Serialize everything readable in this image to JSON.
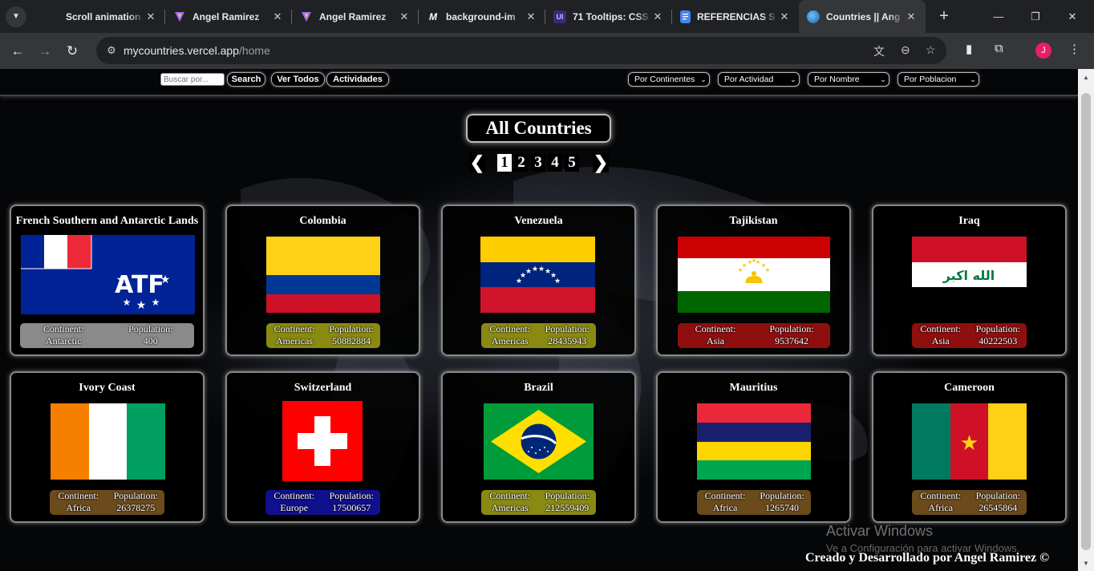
{
  "browser": {
    "tabs": [
      {
        "title": "Scroll animation",
        "icon": "blank-icon"
      },
      {
        "title": "Angel Ramirez",
        "icon": "vite-icon"
      },
      {
        "title": "Angel Ramirez",
        "icon": "vite-icon"
      },
      {
        "title": "background-im",
        "icon": "m-icon"
      },
      {
        "title": "71 Tooltips: CSS",
        "icon": "ui-icon"
      },
      {
        "title": "REFERENCIAS S",
        "icon": "docs-icon"
      },
      {
        "title": "Countries || Ang",
        "icon": "globe-icon"
      }
    ],
    "url_host": "mycountries.vercel.app",
    "url_path": "/home",
    "avatar_letter": "J"
  },
  "navbar": {
    "search_placeholder": "Buscar por...",
    "search_button": "Search",
    "ver_todos": "Ver Todos",
    "actividades": "Actividades",
    "filters": [
      "Por Continentes",
      "Por Actividad",
      "Por Nombre",
      "Por Poblacion"
    ]
  },
  "heading": "All Countries",
  "pagination": {
    "prev": "❮",
    "next": "❯",
    "pages": [
      "1",
      "2",
      "3",
      "4",
      "5"
    ],
    "current": "1"
  },
  "cards": [
    {
      "name": "French Southern and Antarctic Lands",
      "continent_label": "Continent:",
      "population_label": "Population:",
      "continent": "Antarctic",
      "population": "400",
      "flag": "atf",
      "info_color": "#8a8a8a"
    },
    {
      "name": "Colombia",
      "continent_label": "Continent:",
      "population_label": "Population:",
      "continent": "Americas",
      "population": "50882884",
      "flag": "co",
      "info_color": "#8a8a12"
    },
    {
      "name": "Venezuela",
      "continent_label": "Continent:",
      "population_label": "Population:",
      "continent": "Americas",
      "population": "28435943",
      "flag": "ve",
      "info_color": "#8a8a12"
    },
    {
      "name": "Tajikistan",
      "continent_label": "Continent:",
      "population_label": "Population:",
      "continent": "Asia",
      "population": "9537642",
      "flag": "tj",
      "info_color": "#8f0f0f"
    },
    {
      "name": "Iraq",
      "continent_label": "Continent:",
      "population_label": "Population:",
      "continent": "Asia",
      "population": "40222503",
      "flag": "iq",
      "info_color": "#8f0f0f"
    },
    {
      "name": "Ivory Coast",
      "continent_label": "Continent:",
      "population_label": "Population:",
      "continent": "Africa",
      "population": "26378275",
      "flag": "ci",
      "info_color": "#6b4a1c"
    },
    {
      "name": "Switzerland",
      "continent_label": "Continent:",
      "population_label": "Population:",
      "continent": "Europe",
      "population": "17500657",
      "flag": "ch",
      "info_color": "#10108f"
    },
    {
      "name": "Brazil",
      "continent_label": "Continent:",
      "population_label": "Population:",
      "continent": "Americas",
      "population": "212559409",
      "flag": "br",
      "info_color": "#8a8a12"
    },
    {
      "name": "Mauritius",
      "continent_label": "Continent:",
      "population_label": "Population:",
      "continent": "Africa",
      "population": "1265740",
      "flag": "mu",
      "info_color": "#6b4a1c"
    },
    {
      "name": "Cameroon",
      "continent_label": "Continent:",
      "population_label": "Population:",
      "continent": "Africa",
      "population": "26545864",
      "flag": "cm",
      "info_color": "#6b4a1c"
    }
  ],
  "footer": "Creado y Desarrollado por Angel Ramirez ©",
  "watermark": {
    "title": "Activar Windows",
    "subtitle": "Ve a Configuración para activar Windows."
  }
}
